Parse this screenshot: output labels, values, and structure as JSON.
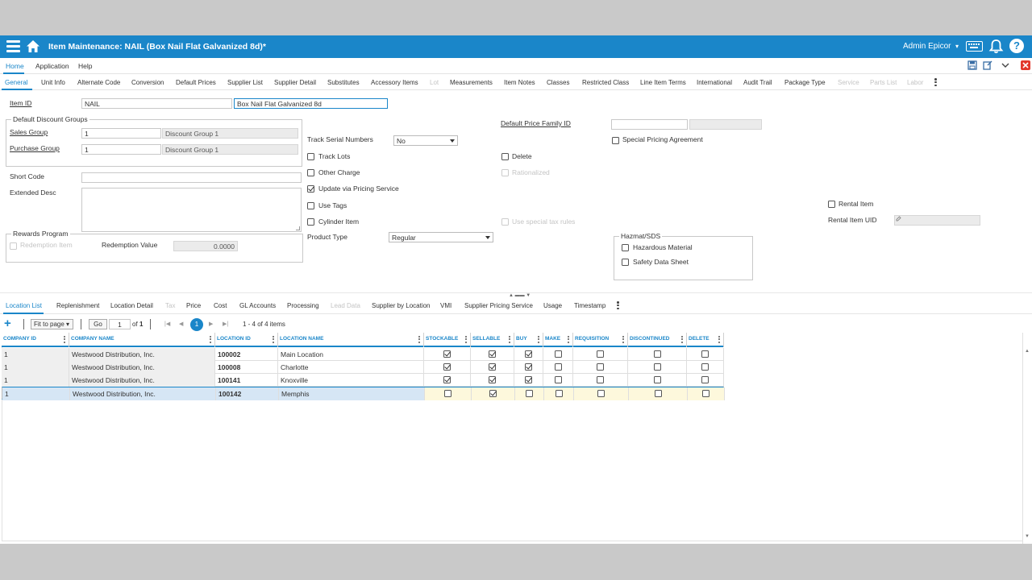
{
  "app": {
    "title": "Item Maintenance: NAIL (Box Nail Flat Galvanized 8d)*",
    "user": "Admin Epicor"
  },
  "menu": {
    "items": [
      "Home",
      "Application",
      "Help"
    ]
  },
  "tabs": [
    "General",
    "Unit Info",
    "Alternate Code",
    "Conversion",
    "Default Prices",
    "Supplier List",
    "Supplier Detail",
    "Substitutes",
    "Accessory Items",
    "Lot",
    "Measurements",
    "Item Notes",
    "Classes",
    "Restricted Class",
    "Line Item Terms",
    "International",
    "Audit Trail",
    "Package Type",
    "Service",
    "Parts List",
    "Labor"
  ],
  "form": {
    "item_id_label": "Item ID",
    "item_id": "NAIL",
    "item_desc": "Box Nail Flat Galvanized 8d",
    "discount_groups_legend": "Default Discount Groups",
    "sales_group_label": "Sales Group",
    "sales_group": "1",
    "sales_group_desc": "Discount Group 1",
    "purchase_group_label": "Purchase Group",
    "purchase_group": "1",
    "purchase_group_desc": "Discount Group 1",
    "short_code_label": "Short Code",
    "short_code": "",
    "extended_desc_label": "Extended Desc",
    "rewards_legend": "Rewards Program",
    "redemption_item_label": "Redemption Item",
    "redemption_value_label": "Redemption Value",
    "redemption_value": "0.0000",
    "track_serial_label": "Track Serial Numbers",
    "track_serial_value": "No",
    "track_lots_label": "Track Lots",
    "other_charge_label": "Other Charge",
    "update_pricing_label": "Update via Pricing Service",
    "use_tags_label": "Use Tags",
    "cylinder_item_label": "Cylinder Item",
    "product_type_label": "Product Type",
    "product_type_value": "Regular",
    "default_price_family_label": "Default Price Family ID",
    "special_pricing_label": "Special Pricing Agreement",
    "delete_label": "Delete",
    "rationalized_label": "Rationalized",
    "use_special_tax_label": "Use special tax rules",
    "hazmat_legend": "Hazmat/SDS",
    "hazardous_label": "Hazardous Material",
    "sds_label": "Safety Data Sheet",
    "rental_item_label": "Rental Item",
    "rental_uid_label": "Rental Item UID"
  },
  "location_tabs": [
    "Location List",
    "Replenishment",
    "Location Detail",
    "Tax",
    "Price",
    "Cost",
    "GL Accounts",
    "Processing",
    "Lead Data",
    "Supplier by Location",
    "VMI",
    "Supplier Pricing Service",
    "Usage",
    "Timestamp"
  ],
  "grid_toolbar": {
    "fit_label": "Fit to page",
    "go_label": "Go",
    "page_value": "1",
    "of_label": "of",
    "page_total": "1",
    "current_page": "1",
    "range_text": "1 - 4 of 4 items"
  },
  "grid": {
    "columns": [
      "COMPANY ID",
      "COMPANY NAME",
      "LOCATION ID",
      "LOCATION NAME",
      "STOCKABLE",
      "SELLABLE",
      "BUY",
      "MAKE",
      "REQUISITION",
      "DISCONTINUED",
      "DELETE"
    ],
    "rows": [
      {
        "company_id": "1",
        "company_name": "Westwood Distribution, Inc.",
        "location_id": "100002",
        "location_name": "Main Location",
        "stockable": true,
        "sellable": true,
        "buy": true,
        "make": false,
        "requisition": false,
        "discontinued": false,
        "delete": false
      },
      {
        "company_id": "1",
        "company_name": "Westwood Distribution, Inc.",
        "location_id": "100008",
        "location_name": "Charlotte",
        "stockable": true,
        "sellable": true,
        "buy": true,
        "make": false,
        "requisition": false,
        "discontinued": false,
        "delete": false
      },
      {
        "company_id": "1",
        "company_name": "Westwood Distribution, Inc.",
        "location_id": "100141",
        "location_name": "Knoxville",
        "stockable": true,
        "sellable": true,
        "buy": true,
        "make": false,
        "requisition": false,
        "discontinued": false,
        "delete": false
      },
      {
        "company_id": "1",
        "company_name": "Westwood Distribution, Inc.",
        "location_id": "100142",
        "location_name": "Memphis",
        "stockable": false,
        "sellable": true,
        "buy": false,
        "make": false,
        "requisition": false,
        "discontinued": false,
        "delete": false
      }
    ]
  },
  "colors": {
    "accent": "#1a86c9",
    "close": "#e2372b"
  }
}
